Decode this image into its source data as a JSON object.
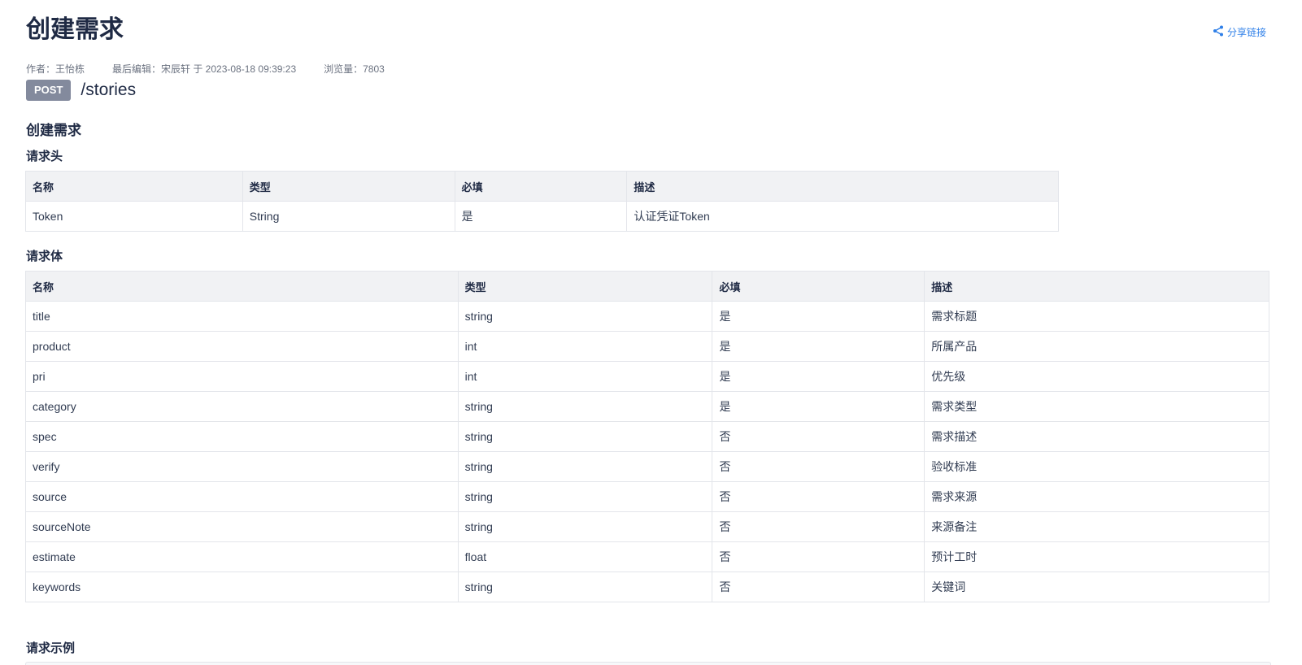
{
  "page": {
    "title": "创建需求",
    "share_label": "分享链接"
  },
  "meta": {
    "author": "作者：王怡栋",
    "last_edit": "最后编辑：宋辰轩 于 2023-08-18 09:39:23",
    "views": "浏览量：7803"
  },
  "endpoint": {
    "method": "POST",
    "path": "/stories"
  },
  "description": "创建需求",
  "request_header": {
    "heading": "请求头",
    "columns": [
      "名称",
      "类型",
      "必填",
      "描述"
    ],
    "rows": [
      [
        "Token",
        "String",
        "是",
        "认证凭证Token"
      ]
    ]
  },
  "request_body": {
    "heading": "请求体",
    "columns": [
      "名称",
      "类型",
      "必填",
      "描述"
    ],
    "rows": [
      [
        "title",
        "string",
        "是",
        "需求标题"
      ],
      [
        "product",
        "int",
        "是",
        "所属产品"
      ],
      [
        "pri",
        "int",
        "是",
        "优先级"
      ],
      [
        "category",
        "string",
        "是",
        "需求类型"
      ],
      [
        "spec",
        "string",
        "否",
        "需求描述"
      ],
      [
        "verify",
        "string",
        "否",
        "验收标准"
      ],
      [
        "source",
        "string",
        "否",
        "需求来源"
      ],
      [
        "sourceNote",
        "string",
        "否",
        "来源备注"
      ],
      [
        "estimate",
        "float",
        "否",
        "预计工时"
      ],
      [
        "keywords",
        "string",
        "否",
        "关键词"
      ]
    ]
  },
  "request_example": {
    "heading": "请求示例"
  },
  "icons": {
    "share": "share-icon"
  },
  "colors": {
    "accent": "#2e7fe8",
    "method_badge": "#838a9d"
  }
}
